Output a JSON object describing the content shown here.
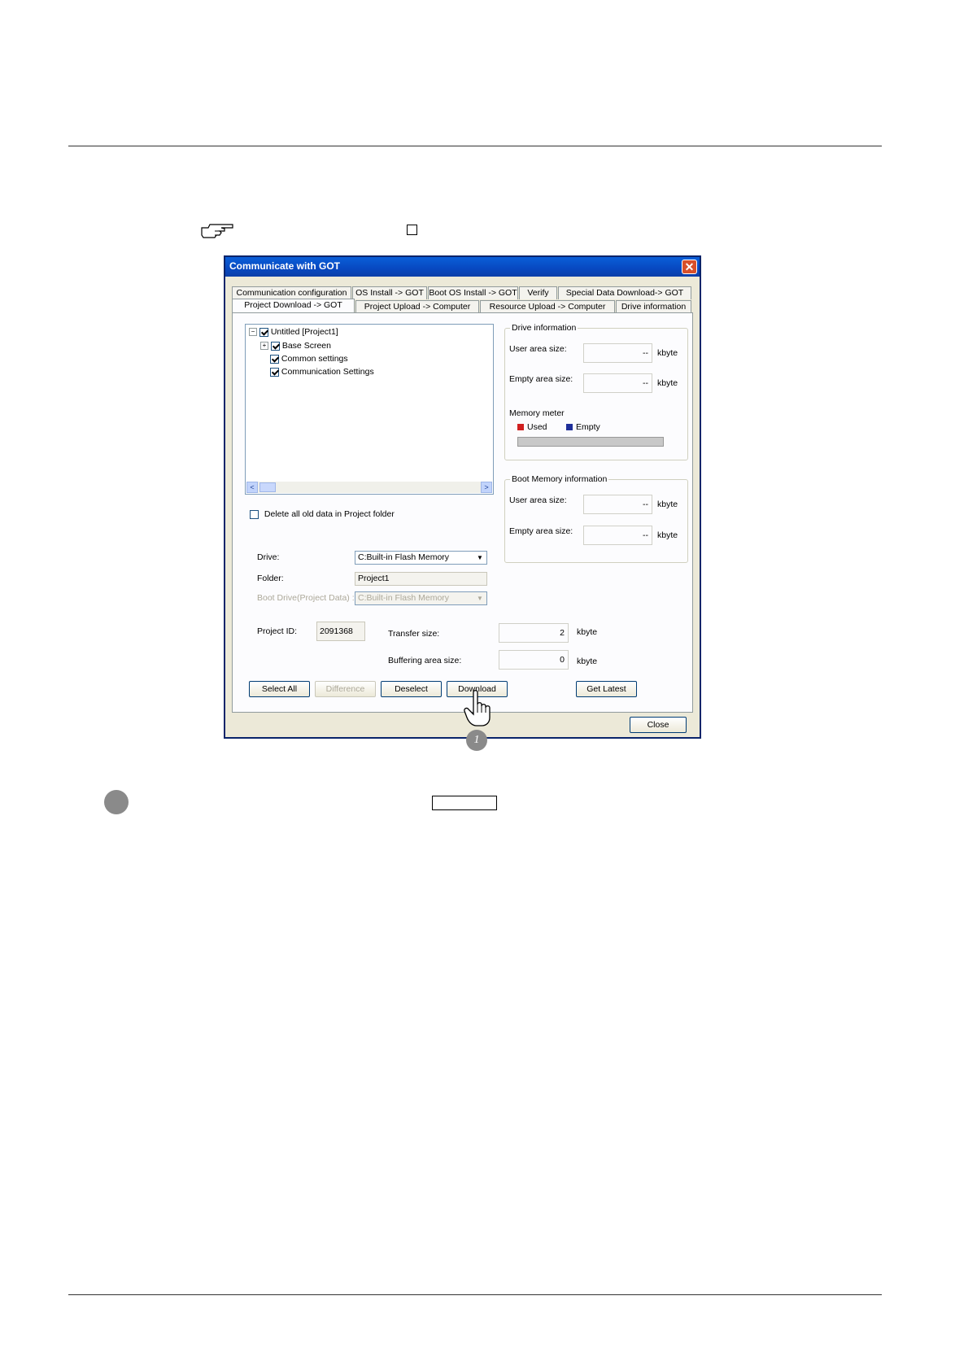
{
  "dialog": {
    "title": "Communicate with GOT",
    "close_glyph": "✕",
    "tabs_row1": [
      "Communication configuration",
      "OS Install -> GOT",
      "Boot OS Install -> GOT",
      "Verify",
      "Special Data Download-> GOT"
    ],
    "tabs_row2": [
      "Project Download -> GOT",
      "Project Upload -> Computer",
      "Resource Upload -> Computer",
      "Drive information"
    ],
    "tree": {
      "root": "Untitled [Project1]",
      "children": [
        "Base Screen",
        "Common settings",
        "Communication Settings"
      ]
    },
    "delete_old_label": "Delete all old data in Project folder",
    "drive_info": {
      "title": "Drive information",
      "user_area_label": "User area size:",
      "user_area_value": "--",
      "empty_area_label": "Empty area size:",
      "empty_area_value": "--",
      "unit": "kbyte",
      "memory_meter_label": "Memory meter",
      "used_label": "Used",
      "empty_label": "Empty",
      "used_color": "#d02020",
      "empty_color": "#1f2f9a"
    },
    "boot_info": {
      "title": "Boot Memory information",
      "user_area_label": "User area size:",
      "user_area_value": "--",
      "empty_area_label": "Empty area size:",
      "empty_area_value": "--",
      "unit": "kbyte"
    },
    "drive_label": "Drive:",
    "drive_value": "C:Built-in Flash Memory",
    "folder_label": "Folder:",
    "folder_value": "Project1",
    "boot_drive_label": "Boot Drive(Project Data) :",
    "boot_drive_value": "C:Built-in Flash Memory",
    "project_id_label": "Project ID:",
    "project_id_value": "2091368",
    "transfer_size_label": "Transfer size:",
    "transfer_size_value": "2",
    "buffering_label": "Buffering area size:",
    "buffering_value": "0",
    "unit": "kbyte",
    "buttons": {
      "select_all": "Select All",
      "difference": "Difference",
      "deselect": "Deselect",
      "download": "Download",
      "get_latest": "Get Latest",
      "close": "Close"
    }
  },
  "callout_number": "1"
}
